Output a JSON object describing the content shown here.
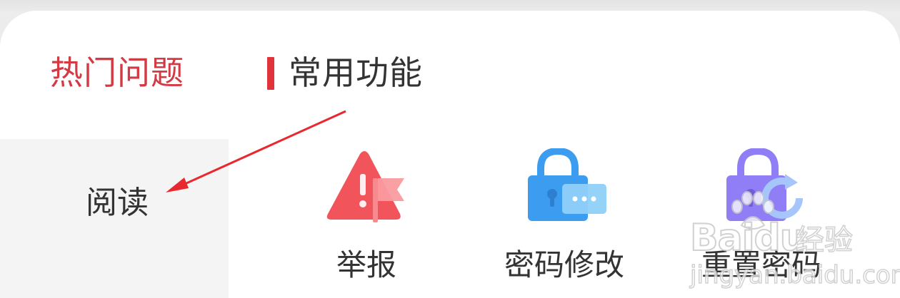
{
  "tabs": {
    "hot_label": "热门问题",
    "common_label": "常用功能"
  },
  "sidebar": {
    "items": [
      {
        "label": "阅读"
      }
    ]
  },
  "features": [
    {
      "label": "举报",
      "icon": "report-warning-flag-icon"
    },
    {
      "label": "密码修改",
      "icon": "lock-password-change-icon"
    },
    {
      "label": "重置密码",
      "icon": "lock-reset-icon"
    }
  ],
  "watermark": {
    "brand": "Baidu",
    "cn": "经验",
    "url": "jingyan.baidu.com"
  },
  "colors": {
    "accent_red": "#d43a44",
    "indicator_red": "#e0333c",
    "report_red": "#f2545b",
    "lock_blue": "#3b9cf0",
    "lock_purple": "#8f7ef5",
    "text_dark": "#333333",
    "sidebar_bg": "#f4f4f4"
  }
}
